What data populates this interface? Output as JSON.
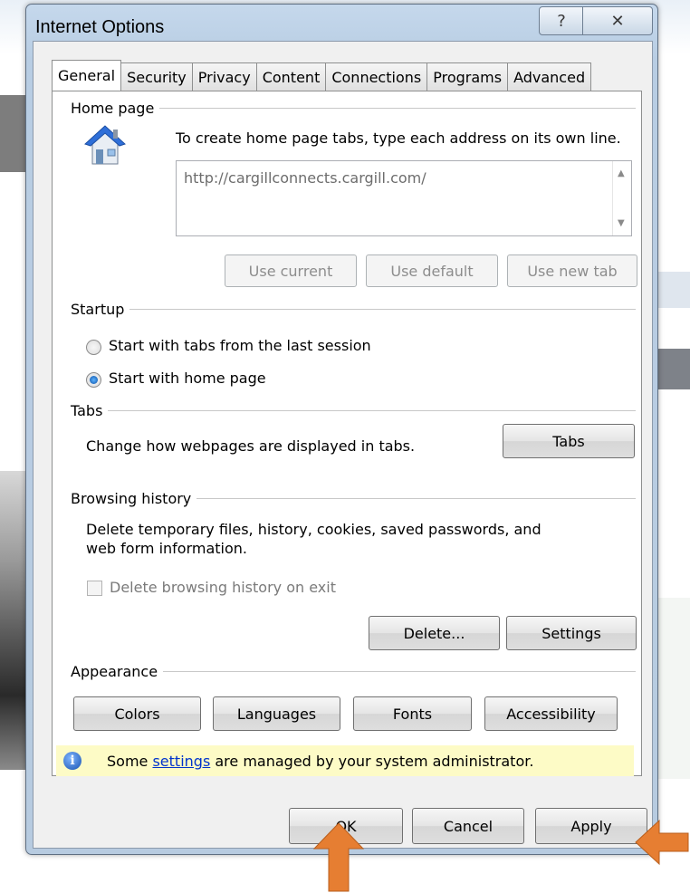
{
  "window": {
    "title": "Internet Options",
    "help_glyph": "?",
    "close_glyph": "✕"
  },
  "tabs": [
    {
      "label": "General",
      "active": true
    },
    {
      "label": "Security"
    },
    {
      "label": "Privacy"
    },
    {
      "label": "Content"
    },
    {
      "label": "Connections"
    },
    {
      "label": "Programs"
    },
    {
      "label": "Advanced"
    }
  ],
  "home_page": {
    "group_label": "Home page",
    "instruction": "To create home page tabs, type each address on its own line.",
    "url_value": "http://cargillconnects.cargill.com/",
    "buttons": {
      "use_current": "Use current",
      "use_default": "Use default",
      "use_new_tab": "Use new tab"
    },
    "icon": "house-icon"
  },
  "startup": {
    "group_label": "Startup",
    "options": [
      {
        "label": "Start with tabs from the last session",
        "checked": false
      },
      {
        "label": "Start with home page",
        "checked": true
      }
    ]
  },
  "tabs_group": {
    "group_label": "Tabs",
    "description": "Change how webpages are displayed in tabs.",
    "button": "Tabs"
  },
  "browsing_history": {
    "group_label": "Browsing history",
    "description_line1": "Delete temporary files, history, cookies, saved passwords, and",
    "description_line2": "web form information.",
    "checkbox_label": "Delete browsing history on exit",
    "delete_button": "Delete...",
    "settings_button": "Settings"
  },
  "appearance": {
    "group_label": "Appearance",
    "buttons": [
      "Colors",
      "Languages",
      "Fonts",
      "Accessibility"
    ]
  },
  "info_bar": {
    "prefix": "Some ",
    "link": "settings",
    "suffix": " are managed by your system administrator.",
    "icon": "info-icon"
  },
  "footer": {
    "ok": "OK",
    "cancel": "Cancel",
    "apply": "Apply"
  },
  "colors": {
    "annotation_arrow": "#e67e32",
    "title_bar": "#c5d8ec",
    "info_bar": "#fdfbc6"
  }
}
